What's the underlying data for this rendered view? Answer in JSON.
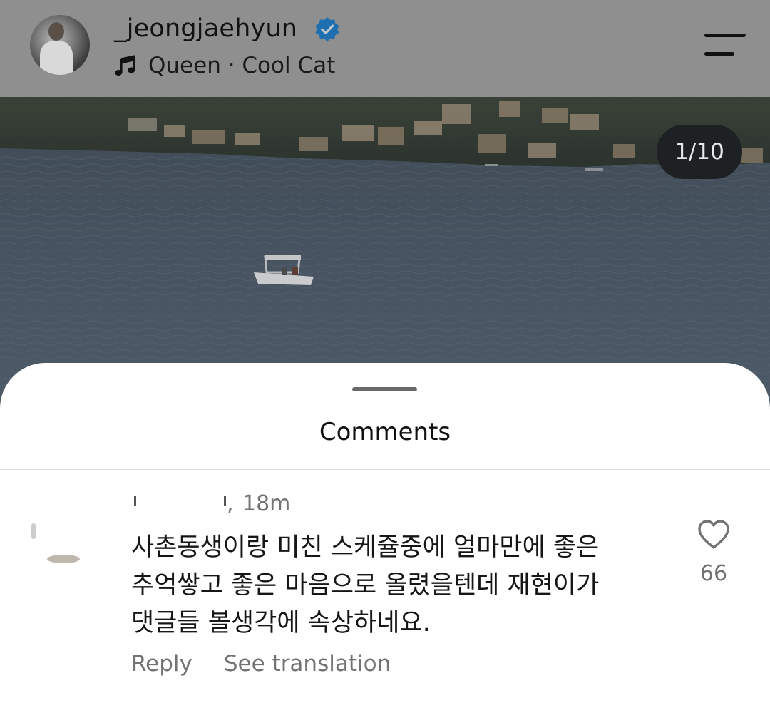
{
  "header": {
    "username": "_jeongjaehyun",
    "verified": true,
    "music": {
      "icon": "music-note-icon",
      "track": "Queen · Cool Cat"
    },
    "menu_icon": "hamburger-menu-icon"
  },
  "post": {
    "page_indicator": "1/10"
  },
  "comments_sheet": {
    "title": "Comments",
    "comment": {
      "time": "18m",
      "text_lines": [
        "사촌동생이랑 미친 스케쥴중에 얼마만에 좋은",
        "추억쌓고 좋은 마음으로 올렸을텐데 재현이가",
        "댓글들 볼생각에 속상하네요."
      ],
      "reply_label": "Reply",
      "translate_label": "See translation",
      "like_icon": "heart-outline-icon",
      "like_count": "66"
    }
  },
  "colors": {
    "overlay_dim": "#8f8f8f",
    "verified_blue": "#0095f6",
    "secondary_text": "#737373",
    "primary_text": "#111111",
    "indicator_bg": "#1d2124"
  }
}
